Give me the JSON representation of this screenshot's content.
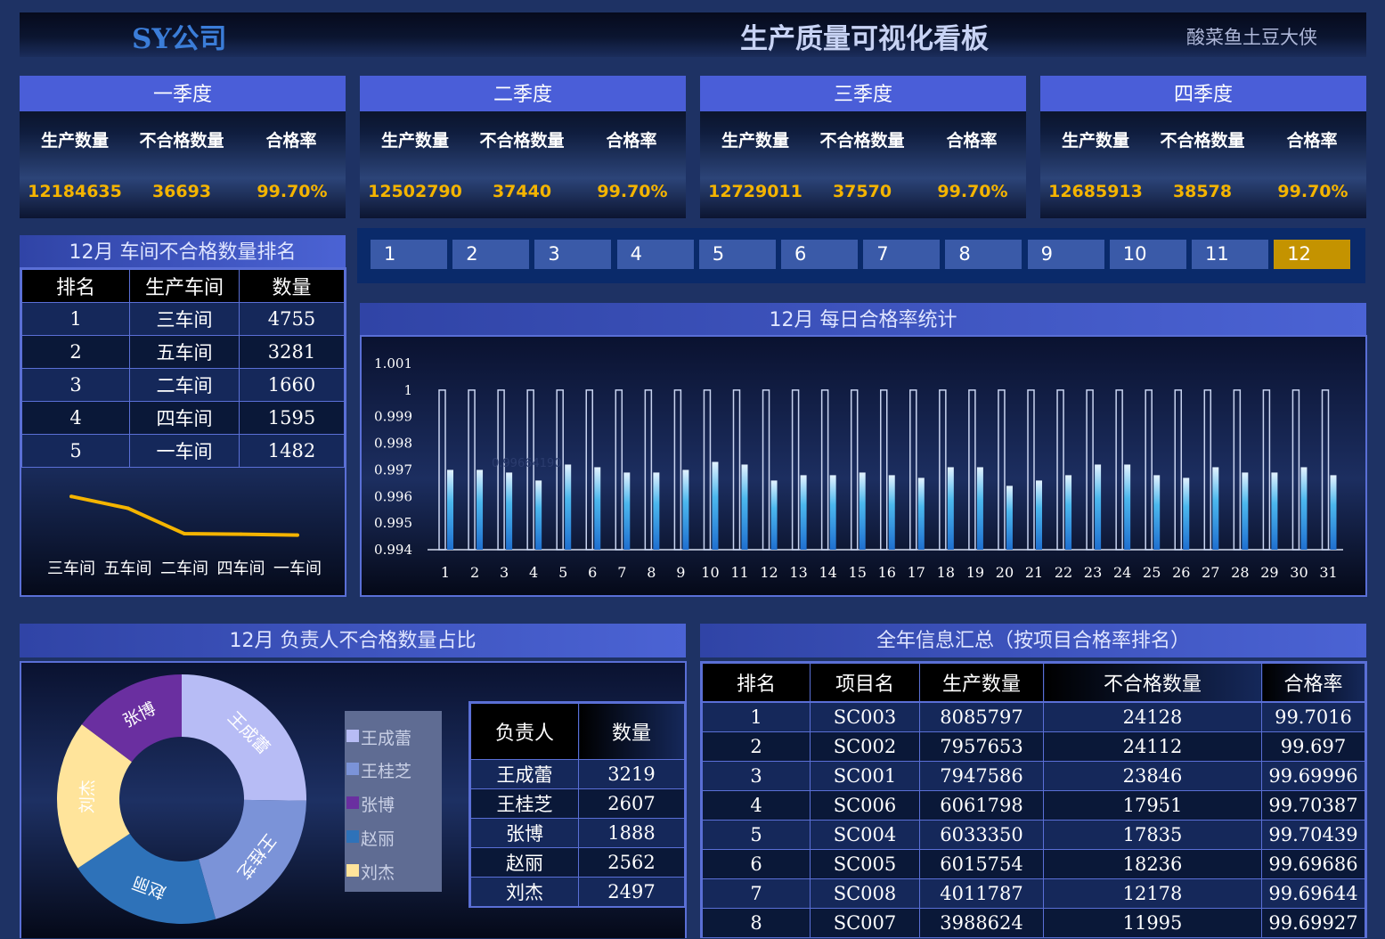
{
  "header": {
    "company": "SY公司",
    "title": "生产质量可视化看板",
    "author": "酸菜鱼土豆大侠"
  },
  "quarters": [
    {
      "name": "一季度",
      "labels": [
        "生产数量",
        "不合格数量",
        "合格率"
      ],
      "values": [
        "12184635",
        "36693",
        "99.70%"
      ]
    },
    {
      "name": "二季度",
      "labels": [
        "生产数量",
        "不合格数量",
        "合格率"
      ],
      "values": [
        "12502790",
        "37440",
        "99.70%"
      ]
    },
    {
      "name": "三季度",
      "labels": [
        "生产数量",
        "不合格数量",
        "合格率"
      ],
      "values": [
        "12729011",
        "37570",
        "99.70%"
      ]
    },
    {
      "name": "四季度",
      "labels": [
        "生产数量",
        "不合格数量",
        "合格率"
      ],
      "values": [
        "12685913",
        "38578",
        "99.70%"
      ]
    }
  ],
  "workshop_rank": {
    "title": "12月 车间不合格数量排名",
    "headers": [
      "排名",
      "生产车间",
      "数量"
    ],
    "rows": [
      [
        "1",
        "三车间",
        "4755"
      ],
      [
        "2",
        "五车间",
        "3281"
      ],
      [
        "3",
        "二车间",
        "1660"
      ],
      [
        "4",
        "四车间",
        "1595"
      ],
      [
        "5",
        "一车间",
        "1482"
      ]
    ]
  },
  "months": {
    "items": [
      "1",
      "2",
      "3",
      "4",
      "5",
      "6",
      "7",
      "8",
      "9",
      "10",
      "11",
      "12"
    ],
    "selected": "12"
  },
  "daily": {
    "title": "12月 每日合格率统计",
    "stray_label": "0.99664190"
  },
  "owner": {
    "title": "12月 负责人不合格数量占比",
    "headers": [
      "负责人",
      "数量"
    ],
    "rows": [
      [
        "王成蕾",
        "3219"
      ],
      [
        "王桂芝",
        "2607"
      ],
      [
        "张博",
        "1888"
      ],
      [
        "赵丽",
        "2562"
      ],
      [
        "刘杰",
        "2497"
      ]
    ]
  },
  "annual": {
    "title": "全年信息汇总（按项目合格率排名）",
    "headers": [
      "排名",
      "项目名",
      "生产数量",
      "不合格数量",
      "合格率"
    ],
    "rows": [
      [
        "1",
        "SC003",
        "8085797",
        "24128",
        "99.7016"
      ],
      [
        "2",
        "SC002",
        "7957653",
        "24112",
        "99.697"
      ],
      [
        "3",
        "SC001",
        "7947586",
        "23846",
        "99.69996"
      ],
      [
        "4",
        "SC006",
        "6061798",
        "17951",
        "99.70387"
      ],
      [
        "5",
        "SC004",
        "6033350",
        "17835",
        "99.70439"
      ],
      [
        "6",
        "SC005",
        "6015754",
        "18236",
        "99.69686"
      ],
      [
        "7",
        "SC008",
        "4011787",
        "12178",
        "99.69644"
      ],
      [
        "8",
        "SC007",
        "3988624",
        "11995",
        "99.69927"
      ]
    ]
  },
  "colors": {
    "accent": "#4a5ed8",
    "gold": "#f4b400",
    "selected_month": "#c49300",
    "bar": "#29a3e0"
  },
  "chart_data": [
    {
      "type": "line",
      "categories": [
        "三车间",
        "五车间",
        "二车间",
        "四车间",
        "一车间"
      ],
      "values": [
        4755,
        3281,
        1660,
        1595,
        1482
      ],
      "ylim": [
        0,
        5000
      ]
    },
    {
      "type": "bar",
      "categories": [
        "1",
        "2",
        "3",
        "4",
        "5",
        "6",
        "7",
        "8",
        "9",
        "10",
        "11",
        "12",
        "13",
        "14",
        "15",
        "16",
        "17",
        "18",
        "19",
        "20",
        "21",
        "22",
        "23",
        "24",
        "25",
        "26",
        "27",
        "28",
        "29",
        "30",
        "31"
      ],
      "series": [
        {
          "values": [
            0.997,
            0.997,
            0.9969,
            0.9966,
            0.9972,
            0.9971,
            0.9969,
            0.9969,
            0.997,
            0.9973,
            0.9972,
            0.9966,
            0.9968,
            0.9968,
            0.9969,
            0.9968,
            0.9967,
            0.9971,
            0.9971,
            0.9964,
            0.9966,
            0.9968,
            0.9972,
            0.9972,
            0.9968,
            0.9967,
            0.9971,
            0.9969,
            0.9969,
            0.9971,
            0.9968
          ]
        },
        {
          "values": [
            1,
            1,
            1,
            1,
            1,
            1,
            1,
            1,
            1,
            1,
            1,
            1,
            1,
            1,
            1,
            1,
            1,
            1,
            1,
            1,
            1,
            1,
            1,
            1,
            1,
            1,
            1,
            1,
            1,
            1,
            1
          ]
        }
      ],
      "yticks": [
        "1.001",
        "1",
        "0.999",
        "0.998",
        "0.997",
        "0.996",
        "0.995",
        "0.994"
      ],
      "ylim": [
        0.994,
        1.001
      ],
      "grid": false,
      "legend": "none"
    },
    {
      "type": "pie",
      "categories": [
        "王成蕾",
        "王桂芝",
        "赵丽",
        "刘杰",
        "张博"
      ],
      "values": [
        3219,
        2607,
        2562,
        2497,
        1888
      ],
      "colors": [
        "#b7bcf5",
        "#7b93d8",
        "#2e72b9",
        "#ffe49b",
        "#6a2fa0"
      ]
    }
  ]
}
